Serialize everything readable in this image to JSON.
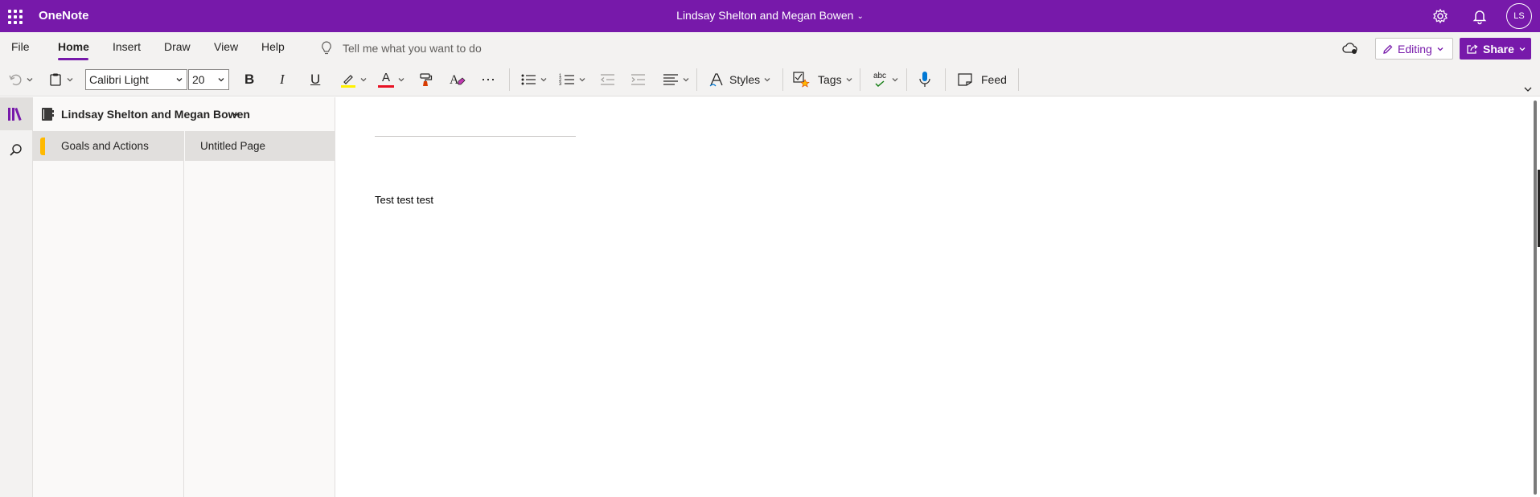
{
  "titlebar": {
    "app_name": "OneNote",
    "notebook_title": "Lindsay Shelton and Megan Bowen",
    "avatar_initials": "LS",
    "brand_color": "#7719aa"
  },
  "menu": {
    "items": [
      "File",
      "Home",
      "Insert",
      "Draw",
      "View",
      "Help"
    ],
    "active": "Home",
    "tell_me_placeholder": "Tell me what you want to do",
    "editing_label": "Editing",
    "share_label": "Share"
  },
  "ribbon": {
    "font_name": "Calibri Light",
    "font_size": "20",
    "bold_label": "B",
    "italic_label": "I",
    "underline_label": "U",
    "font_color_label": "A",
    "styles_label": "Styles",
    "tags_label": "Tags",
    "spell_label": "abc",
    "feed_label": "Feed",
    "highlight_color": "#fff100",
    "font_color": "#e81123"
  },
  "navigation": {
    "notebook_name": "Lindsay Shelton and Megan Bowen",
    "sections": [
      {
        "label": "Goals and Actions",
        "color": "#ffb900"
      }
    ],
    "pages": [
      {
        "label": "Untitled Page"
      }
    ]
  },
  "page": {
    "title": "",
    "body": "Test test test"
  }
}
